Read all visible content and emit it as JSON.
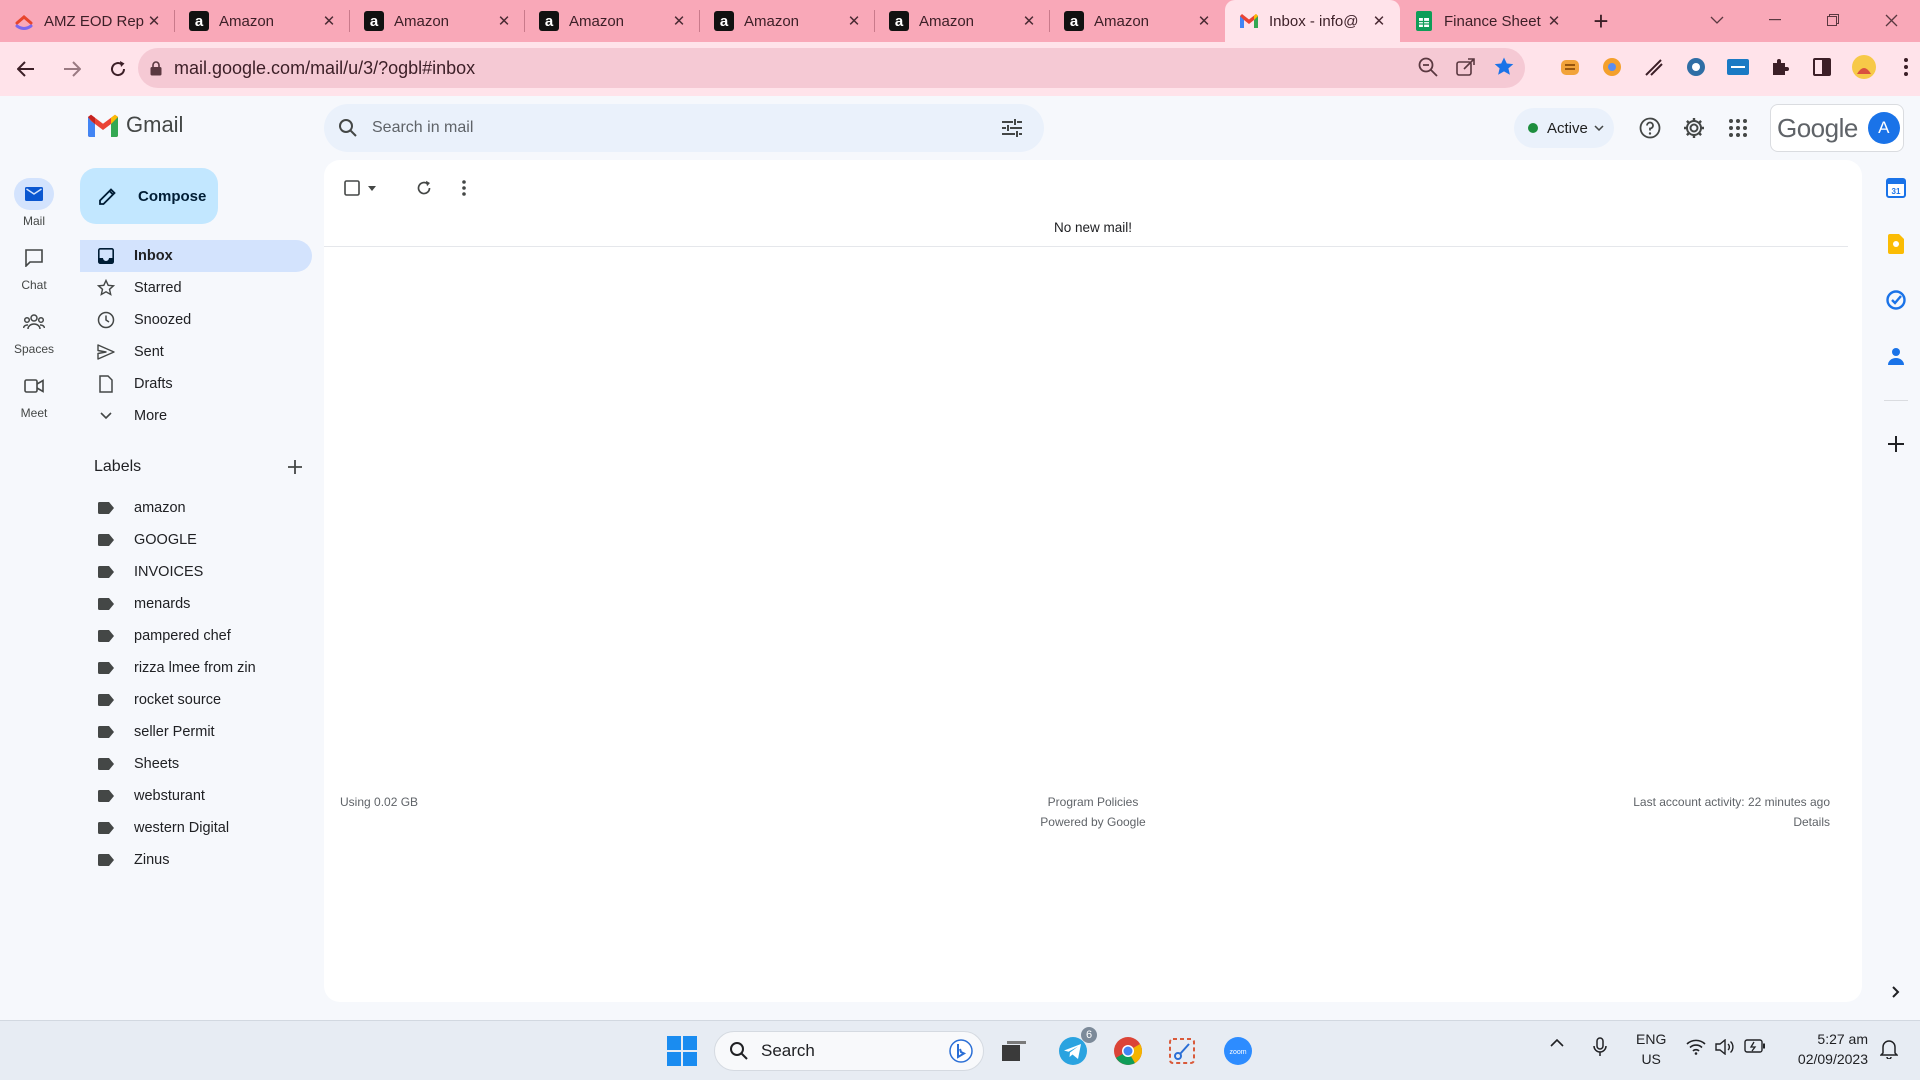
{
  "browser": {
    "tabs": [
      {
        "title": "AMZ EOD Rep",
        "icon": "clickup-icon"
      },
      {
        "title": "Amazon",
        "icon": "amazon-icon"
      },
      {
        "title": "Amazon",
        "icon": "amazon-icon"
      },
      {
        "title": "Amazon",
        "icon": "amazon-icon"
      },
      {
        "title": "Amazon",
        "icon": "amazon-icon"
      },
      {
        "title": "Amazon",
        "icon": "amazon-icon"
      },
      {
        "title": "Amazon",
        "icon": "amazon-icon"
      },
      {
        "title": "Inbox - info@",
        "icon": "gmail-icon",
        "active": true
      },
      {
        "title": "Finance Sheet",
        "icon": "sheets-icon"
      }
    ],
    "url": "mail.google.com/mail/u/3/?ogbl#inbox",
    "tab_bar_color": "#f9a8b8"
  },
  "gmail": {
    "app_name": "Gmail",
    "search_placeholder": "Search in mail",
    "status": "Active",
    "google_word": "Google",
    "avatar_letter": "A",
    "compose_label": "Compose",
    "rail": {
      "mail": "Mail",
      "chat": "Chat",
      "spaces": "Spaces",
      "meet": "Meet"
    },
    "nav": {
      "inbox": "Inbox",
      "starred": "Starred",
      "snoozed": "Snoozed",
      "sent": "Sent",
      "drafts": "Drafts",
      "more": "More"
    },
    "labels_title": "Labels",
    "labels": [
      "amazon",
      "GOOGLE",
      "INVOICES",
      "menards",
      "pampered chef",
      "rizza lmee from zin",
      "rocket source",
      "seller Permit",
      "Sheets",
      "websturant",
      "western Digital",
      "Zinus"
    ],
    "empty_message": "No new mail!",
    "footer": {
      "storage": "Using 0.02 GB",
      "policies": "Program Policies",
      "powered": "Powered by Google",
      "activity": "Last account activity: 22 minutes ago",
      "details": "Details"
    },
    "colors": {
      "accent": "#0b57d0",
      "compose_bg": "#c2e7ff",
      "selected_bg": "#d3e3fd"
    }
  },
  "taskbar": {
    "search_label": "Search",
    "telegram_badge": "6",
    "lang_top": "ENG",
    "lang_bottom": "US",
    "time": "5:27 am",
    "date": "02/09/2023"
  }
}
